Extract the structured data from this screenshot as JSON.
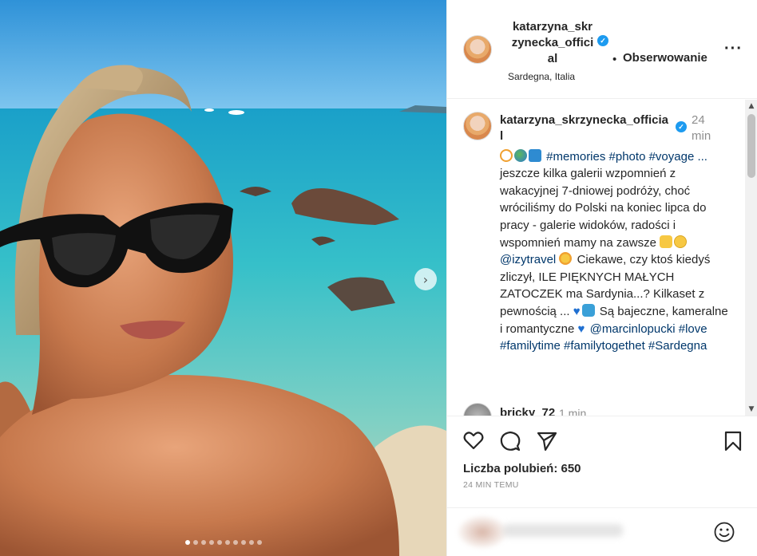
{
  "photo": {
    "next_icon": "chevron-right-icon",
    "carousel_dots": 10,
    "active_dot": 1
  },
  "header": {
    "username_line1": "katarzyna_skr",
    "username_line2": "zynecka_offici",
    "username_line3": "al",
    "follow_separator": "•",
    "follow_label": "Obserwowanie",
    "location": "Sardegna, Italia",
    "more_label": "···"
  },
  "caption": {
    "username": "katarzyna_skrzynecka_officia l",
    "time": "24 min",
    "hashtags_line": "#memories #photo #voyage ...",
    "text_part1": "jeszcze kilka galerii wzpomnień z wakacyjnej 7-dniowej podróży, choć wróciliśmy do Polski na koniec lipca do pracy - galerie widoków, radości i wspomnień mamy na zawsze",
    "mention1": "@izytravel",
    "text_part2": "Ciekawe, czy ktoś kiedyś zliczył, ILE PIĘKNYCH MAŁYCH ZATOCZEK ma Sardynia...? Kilkaset z pewnością ...",
    "text_part3": "Są bajeczne, kameralne i romantyczne",
    "mention2": "@marcinlopucki",
    "tags_end": "#love #familytime #familytogethet #Sardegna"
  },
  "reply": {
    "username": "bricky_72",
    "time": "1 min"
  },
  "actions": {
    "likes_label": "Liczba polubień: 650",
    "time_ago": "24 MIN TEMU"
  },
  "comment_box": {
    "placeholder": ""
  },
  "colors": {
    "link": "#00376b",
    "verified": "#1d9bf0",
    "muted": "#8e8e8e"
  }
}
